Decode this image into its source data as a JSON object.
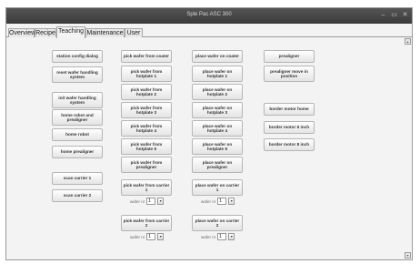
{
  "window": {
    "title": "Sple Pac ASC 300",
    "minimize_glyph": "–",
    "maximize_glyph": "▭",
    "close_glyph": "✕"
  },
  "tabs": [
    {
      "label": "Overview",
      "active": false
    },
    {
      "label": "Recipe",
      "active": false
    },
    {
      "label": "Teaching",
      "active": true
    },
    {
      "label": "Maintenance",
      "active": false
    },
    {
      "label": "User",
      "active": false
    }
  ],
  "col1": {
    "station_config": "station config dialog",
    "reset_wafer_handling": "reset wafer handling system",
    "init_wafer_handling": "init wafer handling system",
    "home_robot_prealigner": "home robot and prealigner",
    "home_robot": "home robot",
    "home_prealigner": "home prealigner",
    "scan_carrier_1": "scan carrier 1",
    "scan_carrier_2": "scan carrier 2"
  },
  "col2": {
    "pick_coater": "pick wafer from coater",
    "pick_hp1": "pick wafer from hotplate 1",
    "pick_hp2": "pick wafer from hotplate 2",
    "pick_hp3": "pick wafer from hotplate 3",
    "pick_hp4": "pick wafer from hotplate 4",
    "pick_hp5": "pick wafer from hotplate 5",
    "pick_prealigner": "pick wafer from prealigner",
    "pick_carrier_1": "pick wafer from carrier 1",
    "pick_carrier_2": "pick wafer from carrier 2"
  },
  "col3": {
    "place_coater": "place wafer on coater",
    "place_hp1": "place wafer on hotplate 1",
    "place_hp2": "place wafer on hotplate 2",
    "place_hp3": "place wafer on hotplate 3",
    "place_hp4": "place wafer on hotplate 4",
    "place_hp5": "place wafer on hotplate 5",
    "place_prealigner": "place wafer on prealigner",
    "place_carrier_1": "place wafer on carrier 1",
    "place_carrier_2": "place wafer on carrier 2"
  },
  "col4": {
    "prealigner": "prealigner",
    "prealigner_move": "prealigner move in position",
    "border_motor_home": "border motor home",
    "border_motor_6": "border motor 6 inch",
    "border_motor_8": "border motor 8 inch"
  },
  "wafer_selectors": {
    "label": "wafer nr",
    "pick_carrier_1": "1",
    "place_carrier_1": "1",
    "pick_carrier_2": "1",
    "place_carrier_2": "1",
    "arrow_glyph": "▾"
  },
  "scroll": {
    "up_glyph": "▴",
    "down_glyph": "▾"
  }
}
